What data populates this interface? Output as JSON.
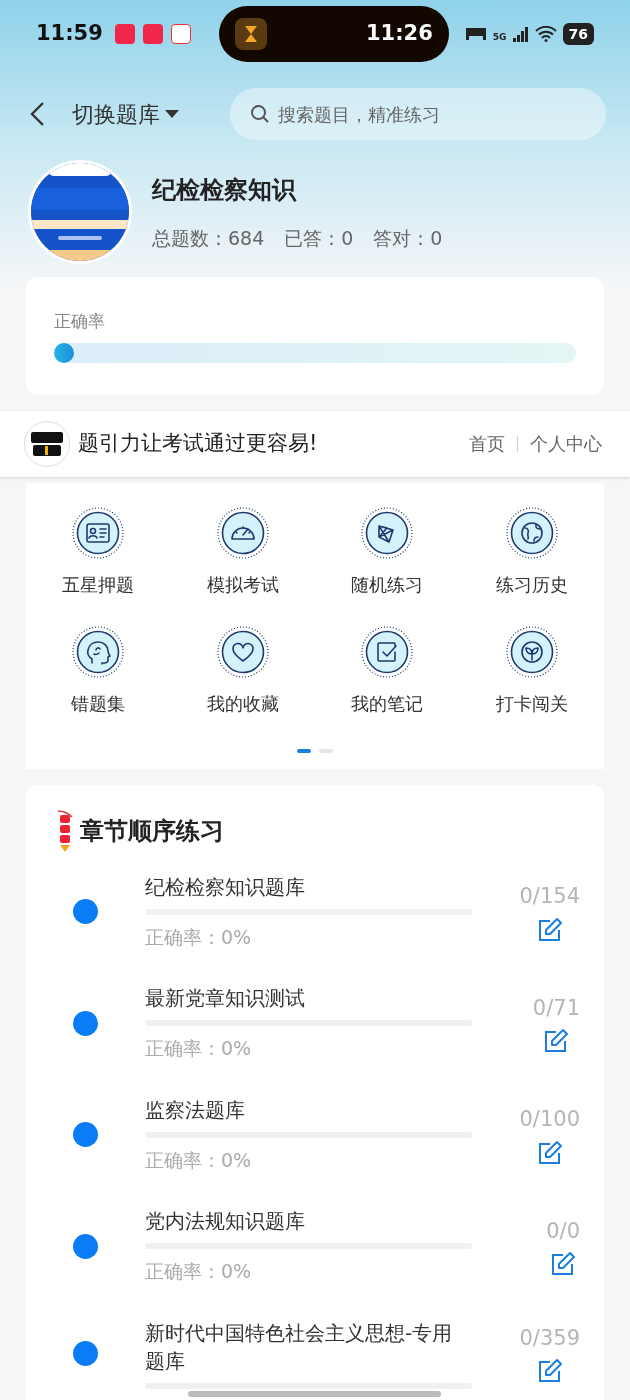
{
  "status_bar": {
    "time": "11:59",
    "island_time": "11:26",
    "network": "5G",
    "battery": "76"
  },
  "header": {
    "switch_label": "切换题库",
    "search": {
      "placeholder": "搜索题目，精准练习"
    }
  },
  "bank": {
    "title": "纪检检察知识",
    "stats": [
      {
        "label": "总题数：",
        "value": "684"
      },
      {
        "label": "已答：",
        "value": "0"
      },
      {
        "label": "答对：",
        "value": "0"
      }
    ]
  },
  "accuracy": {
    "label": "正确率",
    "level": 0
  },
  "banner": {
    "slogan": "题引力让考试通过更容易!",
    "links": [
      "首页",
      "个人中心"
    ]
  },
  "shortcuts": [
    {
      "kind": "card",
      "label": "五星押题"
    },
    {
      "kind": "gauge",
      "label": "模拟考试"
    },
    {
      "kind": "network",
      "label": "随机练习"
    },
    {
      "kind": "globe",
      "label": "练习历史"
    },
    {
      "kind": "head",
      "label": "错题集"
    },
    {
      "kind": "heart",
      "label": "我的收藏"
    },
    {
      "kind": "check",
      "label": "我的笔记"
    },
    {
      "kind": "sprout",
      "label": "打卡闯关"
    }
  ],
  "pager": [
    {
      "selected": true
    },
    {
      "selected": false
    }
  ],
  "chapters": {
    "title": "章节顺序练习",
    "items": [
      {
        "name": "纪检检察知识题库",
        "accuracy": "正确率：0%",
        "count": "0/154"
      },
      {
        "name": "最新党章知识测试",
        "accuracy": "正确率：0%",
        "count": "0/71"
      },
      {
        "name": "监察法题库",
        "accuracy": "正确率：0%",
        "count": "0/100"
      },
      {
        "name": "党内法规知识题库",
        "accuracy": "正确率：0%",
        "count": "0/0"
      },
      {
        "name": "新时代中国特色社会主义思想-专用题库",
        "count": "0/359"
      }
    ]
  }
}
